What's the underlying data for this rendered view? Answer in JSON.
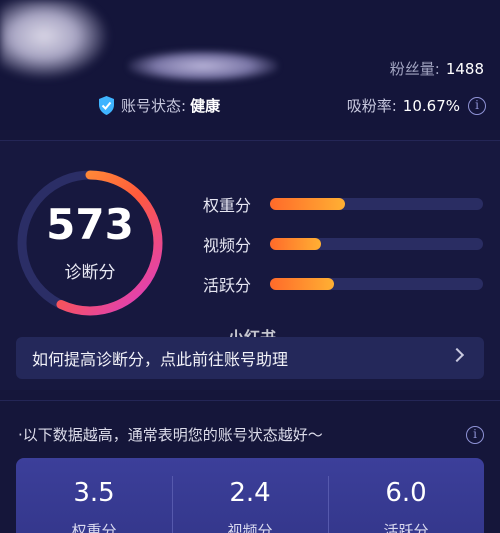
{
  "header": {
    "fans_label": "粉丝量:",
    "fans_value": "1488",
    "status_label": "账号状态:",
    "status_value": "健康",
    "rate_label": "吸粉率:",
    "rate_value": "10.67%"
  },
  "score": {
    "value": "573",
    "label": "诊断分",
    "gauge_fraction": 0.57,
    "metrics": [
      {
        "label": "权重分",
        "fraction": 0.35
      },
      {
        "label": "视频分",
        "fraction": 0.24
      },
      {
        "label": "活跃分",
        "fraction": 0.3
      }
    ]
  },
  "watermark": "小红书",
  "help_text": "如何提高诊断分，点此前往账号助理",
  "note": "·以下数据越高，通常表明您的账号状态越好～",
  "stats": [
    {
      "value": "3.5",
      "label": "权重分"
    },
    {
      "value": "2.4",
      "label": "视频分"
    },
    {
      "value": "6.0",
      "label": "活跃分"
    }
  ],
  "colors": {
    "accent_start": "#ff6a2a",
    "accent_end": "#ffb033",
    "gauge_magenta": "#d93ad0",
    "shield": "#3fb4ff"
  },
  "icons": [
    "shield-check-icon",
    "info-icon",
    "chevron-right-icon"
  ]
}
